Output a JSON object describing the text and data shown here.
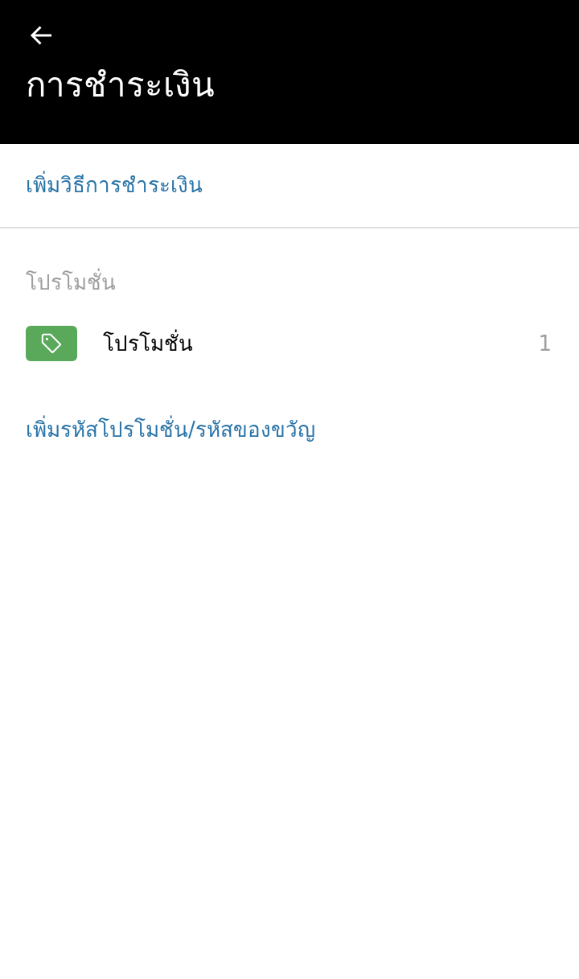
{
  "header": {
    "title": "การชำระเงิน"
  },
  "add_payment_link": "เพิ่มวิธีการชำระเงิน",
  "section_title": "โปรโมชั่น",
  "promotions_row": {
    "label": "โปรโมชั่น",
    "count": "1"
  },
  "add_promo_link": "เพิ่มรหัสโปรโมชั่น/รหัสของขวัญ"
}
